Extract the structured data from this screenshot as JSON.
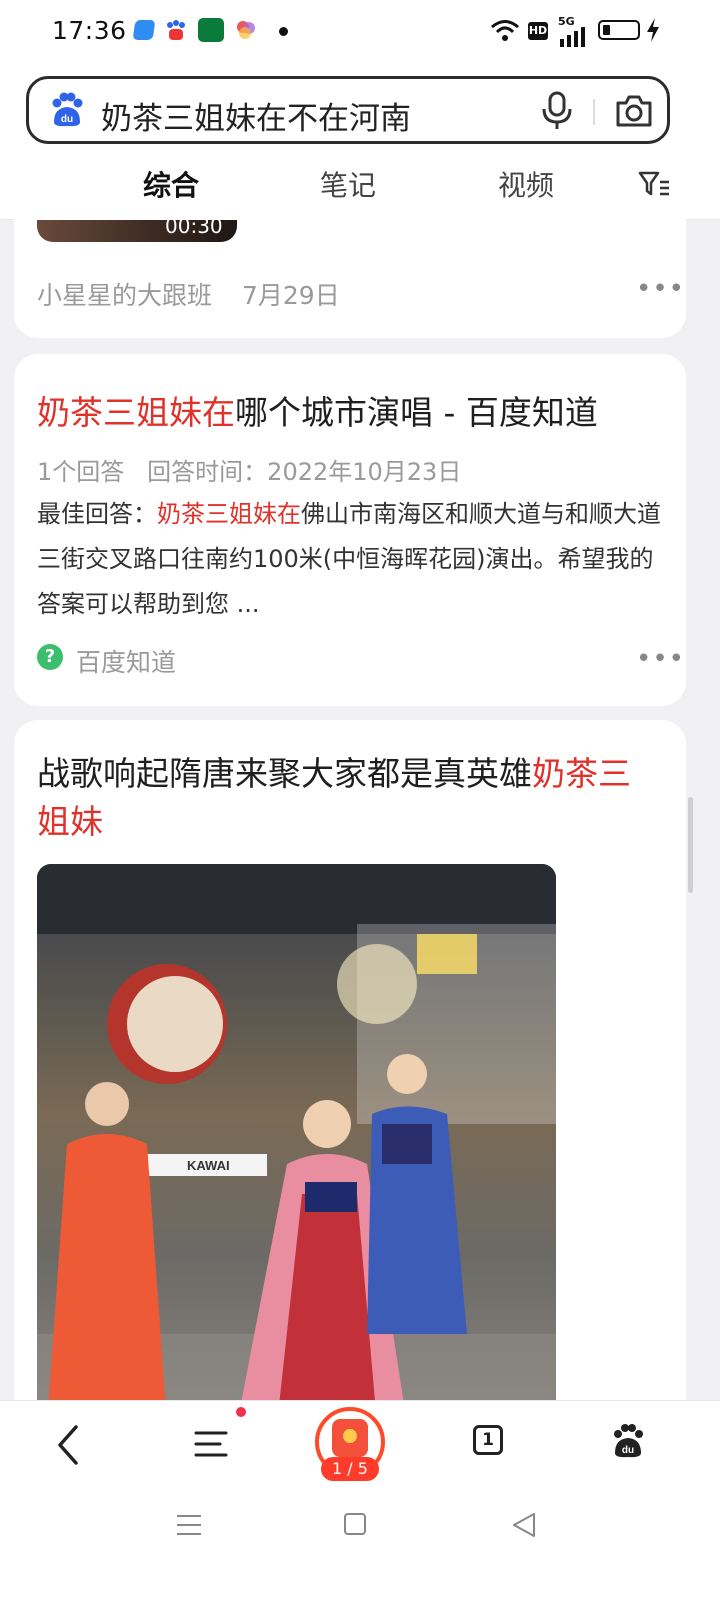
{
  "status_bar": {
    "time": "17:36",
    "hd": "HD",
    "signal": "5G"
  },
  "search": {
    "query": "奶茶三姐妹在不在河南"
  },
  "tabs": [
    "综合",
    "笔记",
    "视频"
  ],
  "card1": {
    "video_time": "00:30",
    "author": "小星星的大跟班",
    "date": "7月29日"
  },
  "card2": {
    "title_red": "奶茶三姐妹在",
    "title_rest": "哪个城市演唱 - 百度知道",
    "meta_count": "1个回答",
    "meta_time": "回答时间：2022年10月23日",
    "answer_prefix": "最佳回答：",
    "answer_red": "奶茶三姐妹在",
    "answer_rest": "佛山市南海区和顺大道与和顺大道三街交叉路口往南约100米(中恒海晖花园)演出。希望我的答案可以帮助到您 ...",
    "source": "百度知道"
  },
  "card3": {
    "title_black": "战歌响起隋唐来聚大家都是真英雄",
    "title_red": "奶茶三姐妹",
    "image_sign": "KAWAI"
  },
  "bottom_nav": {
    "task_progress": "1 / 5",
    "tab_count": "1"
  },
  "colors": {
    "accent_red": "#e0322b",
    "accent_blue": "#3a5cf0"
  }
}
